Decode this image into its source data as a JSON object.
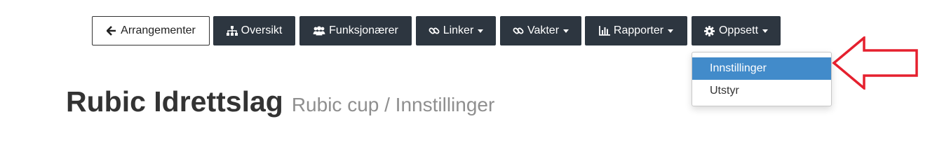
{
  "nav": {
    "back": {
      "label": "Arrangementer",
      "icon": "arrow-left-icon"
    },
    "overview": {
      "label": "Oversikt",
      "icon": "sitemap-icon"
    },
    "officials": {
      "label": "Funksjonærer",
      "icon": "users-icon"
    },
    "links": {
      "label": "Linker",
      "icon": "link-icon"
    },
    "shifts": {
      "label": "Vakter",
      "icon": "link-icon"
    },
    "reports": {
      "label": "Rapporter",
      "icon": "bar-chart-icon"
    },
    "setup": {
      "label": "Oppsett",
      "icon": "gear-icon"
    }
  },
  "dropdown": {
    "items": [
      {
        "label": "Innstillinger",
        "active": true
      },
      {
        "label": "Utstyr",
        "active": false
      }
    ]
  },
  "page": {
    "title": "Rubic Idrettslag",
    "subtitle": "Rubic cup / Innstillinger"
  },
  "colors": {
    "nav_dark": "#2d3640",
    "active_item": "#428bca",
    "annotation_arrow": "#e5202e"
  }
}
